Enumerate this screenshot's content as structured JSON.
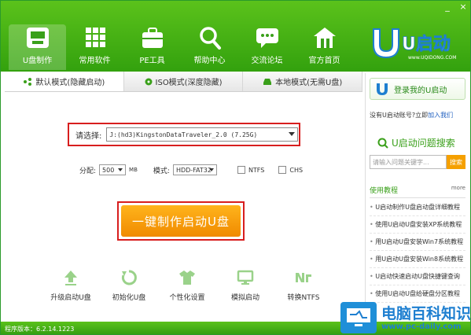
{
  "window_controls": {
    "minimize": "_",
    "close": "×"
  },
  "nav": [
    {
      "label": "U盘制作",
      "icon": "usb-icon"
    },
    {
      "label": "常用软件",
      "icon": "apps-grid-icon"
    },
    {
      "label": "PE工具",
      "icon": "toolbox-icon"
    },
    {
      "label": "帮助中心",
      "icon": "search-icon"
    },
    {
      "label": "交流论坛",
      "icon": "chat-icon"
    },
    {
      "label": "官方首页",
      "icon": "home-icon"
    }
  ],
  "logo": {
    "text": "U启动",
    "url": "www.UQIDONG.COM"
  },
  "tabs": [
    {
      "label": "默认模式(隐藏启动)"
    },
    {
      "label": "ISO模式(深度隐藏)"
    },
    {
      "label": "本地模式(无需U盘)"
    }
  ],
  "device": {
    "label": "请选择:",
    "value": "J:(hd3)KingstonDataTraveler_2.0 (7.25G)"
  },
  "options": {
    "alloc_label": "分配:",
    "alloc_value": "500",
    "alloc_unit": "MB",
    "mode_label": "模式:",
    "mode_value": "HDD-FAT32",
    "ntfs_label": "NTFS",
    "chs_label": "CHS"
  },
  "make_button": "一键制作启动U盘",
  "tools": [
    {
      "label": "升级启动U盘",
      "icon": "upgrade-icon"
    },
    {
      "label": "初始化U盘",
      "icon": "refresh-icon"
    },
    {
      "label": "个性化设置",
      "icon": "shirt-icon"
    },
    {
      "label": "模拟启动",
      "icon": "monitor-icon"
    },
    {
      "label": "转换NTFS",
      "icon": "ntfs-icon"
    }
  ],
  "sidebar": {
    "login": "登录我的U启动",
    "register_text": "没有U启动账号?立即",
    "register_link": "加入我们",
    "question_title": "U启动问题搜索",
    "search_placeholder": "请输入问题关键字...",
    "search_button": "搜索",
    "tutorial_title": "使用教程",
    "more": "more",
    "tutorials": [
      "U启动制作U盘启动盘详细教程",
      "使用U启动U盘安装XP系统教程",
      "用U启动U盘安装Win7系统教程",
      "用U启动U盘安装Win8系统教程",
      "U启动快速启动U盘快捷键查询",
      "使用U启动U盘给硬盘分区教程"
    ]
  },
  "status": "程序版本：6.2.14.1223",
  "watermark": {
    "cn": "电脑百科知识",
    "url": "www.pc-daily.com"
  },
  "colors": {
    "brand_green": "#3aa01a",
    "accent_orange": "#f08a00",
    "highlight_red": "#d81e1e"
  }
}
